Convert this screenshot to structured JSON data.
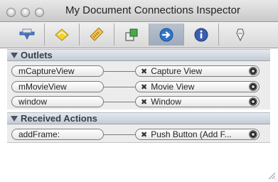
{
  "window": {
    "title": "My Document Connections Inspector"
  },
  "toolbar": {
    "tabs": [
      {
        "icon": "attributes-icon"
      },
      {
        "icon": "effects-icon"
      },
      {
        "icon": "size-ruler-icon"
      },
      {
        "icon": "bindings-icon"
      },
      {
        "icon": "connections-icon",
        "selected": true
      },
      {
        "icon": "info-icon"
      },
      {
        "icon": "more-icon"
      }
    ],
    "accent": "#2e74c9"
  },
  "outlets": {
    "header": "Outlets",
    "rows": [
      {
        "outlet": "mCaptureView",
        "target": "Capture View"
      },
      {
        "outlet": "mMovieView",
        "target": "Movie View"
      },
      {
        "outlet": "window",
        "target": "Window"
      }
    ]
  },
  "actions": {
    "header": "Received Actions",
    "rows": [
      {
        "action": "addFrame:",
        "target": "Push Button (Add F..."
      }
    ]
  },
  "glyphs": {
    "disconnect": "✖"
  }
}
